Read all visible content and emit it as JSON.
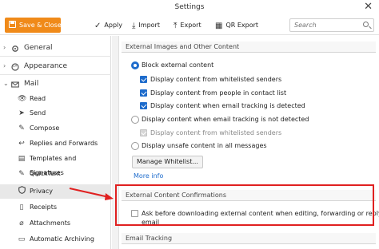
{
  "window": {
    "title": "Settings"
  },
  "toolbar": {
    "save_close": "Save & Close",
    "apply": "Apply",
    "import": "Import",
    "export": "Export",
    "qr_export": "QR Export",
    "search_placeholder": "Search"
  },
  "sidebar": {
    "sections": [
      {
        "label": "General",
        "chevron": "›"
      },
      {
        "label": "Appearance",
        "chevron": "›"
      },
      {
        "label": "Mail",
        "chevron": "⌄"
      }
    ],
    "mail_items": [
      {
        "label": "Read",
        "icon": "eye-icon"
      },
      {
        "label": "Send",
        "icon": "paper-plane-icon"
      },
      {
        "label": "Compose",
        "icon": "pencil-icon"
      },
      {
        "label": "Replies and Forwards",
        "icon": "reply-icon"
      },
      {
        "label": "Templates and Signatures",
        "icon": "template-icon"
      },
      {
        "label": "QuickText",
        "icon": "quicktext-icon"
      },
      {
        "label": "Privacy",
        "icon": "shield-icon",
        "active": true
      },
      {
        "label": "Receipts",
        "icon": "receipt-icon"
      },
      {
        "label": "Attachments",
        "icon": "paperclip-icon"
      },
      {
        "label": "Automatic Archiving",
        "icon": "archive-icon"
      }
    ]
  },
  "external_images": {
    "heading": "External Images and Other Content",
    "block_external": "Block external content",
    "whitelisted": "Display content from whitelisted senders",
    "contact_list": "Display content from people in contact list",
    "tracking_detected": "Display content when email tracking is detected",
    "tracking_not_detected": "Display content when email tracking is not detected",
    "whitelisted_disabled": "Display content from whitelisted senders",
    "unsafe": "Display unsafe content in all messages",
    "manage_whitelist": "Manage Whitelist...",
    "more_info": "More info"
  },
  "confirmations": {
    "heading": "External Content Confirmations",
    "ask_line1": "Ask before downloading external content when editing, forwarding or replying to",
    "ask_line2": "email"
  },
  "email_tracking": {
    "heading": "Email Tracking"
  },
  "colors": {
    "accent": "#f08a19",
    "blue": "#1e6ccc",
    "highlight": "#e02020"
  }
}
